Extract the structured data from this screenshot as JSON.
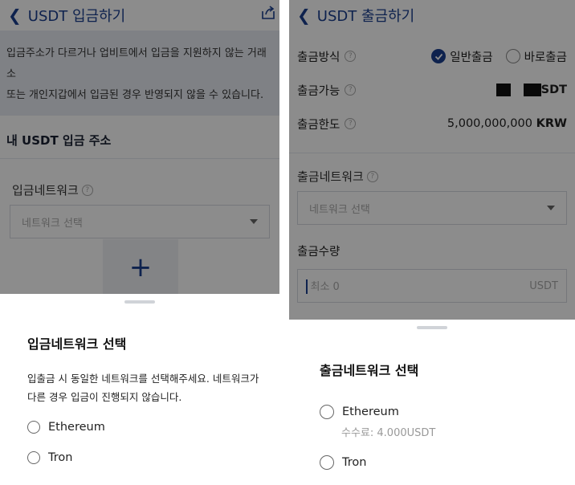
{
  "left": {
    "header_title": "USDT 입금하기",
    "notice_line1": "입금주소가 다르거나 업비트에서 입금을 지원하지 않는 거래소",
    "notice_line2": "또는 개인지갑에서 입금된 경우 반영되지 않을 수 있습니다.",
    "section_title": "내 USDT 입금 주소",
    "network_label": "입금네트워크",
    "network_placeholder": "네트워크 선택",
    "add_symbol": "+",
    "sheet": {
      "title": "입금네트워크 선택",
      "desc_line1": "입출금 시 동일한 네트워크를 선택해주세요. 네트워크가",
      "desc_line2": "다른 경우 입금이 진행되지 않습니다.",
      "options": [
        "Ethereum",
        "Tron"
      ]
    }
  },
  "right": {
    "header_title": "USDT 출금하기",
    "method_label": "출금방식",
    "method_opt1": "일반출금",
    "method_opt2": "바로출금",
    "available_label": "출금가능",
    "available_suffix": "SDT",
    "limit_label": "출금한도",
    "limit_value": "5,000,000,000",
    "limit_unit": "KRW",
    "network_label": "출금네트워크",
    "network_placeholder": "네트워크 선택",
    "amount_label": "출금수량",
    "amount_placeholder": "최소 0",
    "amount_unit": "USDT",
    "sheet": {
      "title": "출금네트워크 선택",
      "options": [
        "Ethereum",
        "Tron"
      ],
      "fee_text": "수수료: 4.000USDT"
    }
  },
  "colors": {
    "brand": "#1a3f8f",
    "overlay": "rgba(0,0,0,0.45)"
  },
  "icons": [
    "back-icon",
    "share-icon",
    "help-icon",
    "caret-down-icon",
    "plus-icon",
    "check-icon"
  ]
}
